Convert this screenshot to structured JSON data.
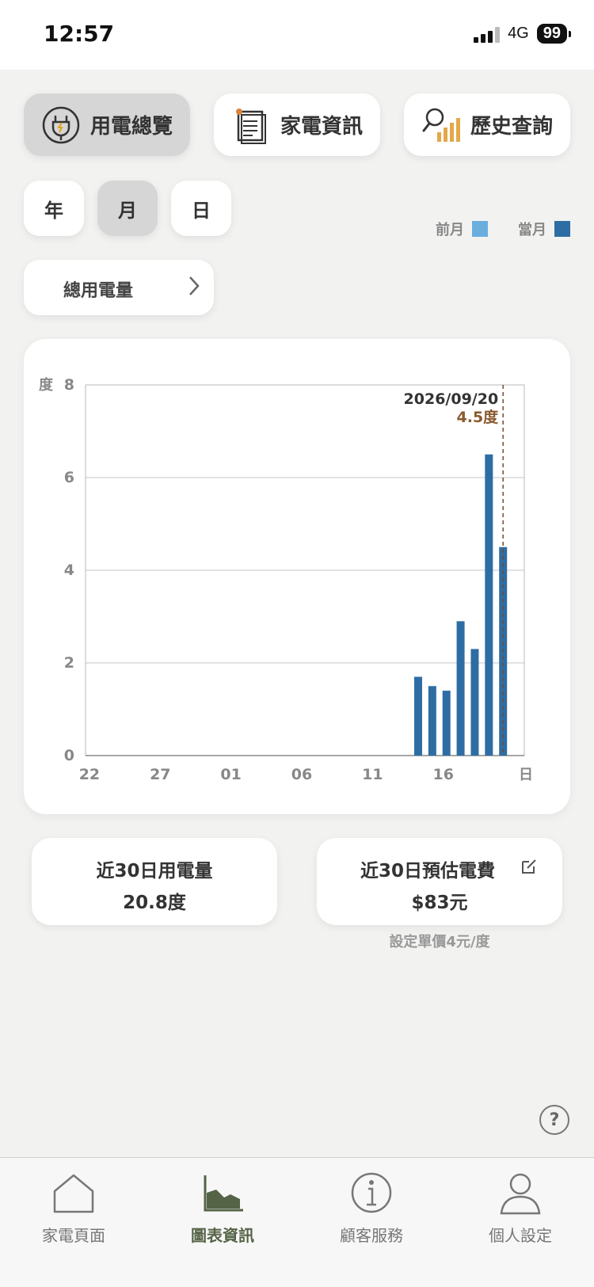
{
  "status_bar": {
    "time": "12:57",
    "network": "4G",
    "battery": "99"
  },
  "top_tabs": [
    {
      "label": "用電總覽",
      "icon": "plug-icon",
      "active": true
    },
    {
      "label": "家電資訊",
      "icon": "document-icon",
      "active": false
    },
    {
      "label": "歷史查詢",
      "icon": "search-chart-icon",
      "active": false
    }
  ],
  "period_tabs": [
    {
      "label": "年",
      "active": false
    },
    {
      "label": "月",
      "active": true
    },
    {
      "label": "日",
      "active": false
    }
  ],
  "legend": {
    "previous": "前月",
    "current": "當月"
  },
  "metric_select": {
    "label": "總用電量"
  },
  "colors": {
    "previous": "#6aaede",
    "current": "#2e6da4",
    "marker": "#7a4a2a",
    "accent": "#556347"
  },
  "chart_data": {
    "type": "bar",
    "ylabel": "度",
    "xlabel": "日",
    "ylim": [
      0,
      8
    ],
    "yticks": [
      0,
      2,
      4,
      6,
      8
    ],
    "xtick_labels": [
      "22",
      "27",
      "01",
      "06",
      "11",
      "16"
    ],
    "xtick_indices": [
      0,
      5,
      10,
      15,
      20,
      25
    ],
    "num_days": 31,
    "series": [
      {
        "name": "當月",
        "points": [
          {
            "day_index": 23,
            "value": 1.7
          },
          {
            "day_index": 24,
            "value": 1.5
          },
          {
            "day_index": 25,
            "value": 1.4
          },
          {
            "day_index": 26,
            "value": 2.9
          },
          {
            "day_index": 27,
            "value": 2.3
          },
          {
            "day_index": 28,
            "value": 6.5
          },
          {
            "day_index": 29,
            "value": 4.5
          }
        ]
      }
    ],
    "selected": {
      "date": "2026/09/20",
      "value_label": "4.5度",
      "day_index": 29
    }
  },
  "stats": {
    "usage_title": "近30日用電量",
    "usage_value": "20.8度",
    "cost_title": "近30日預估電費",
    "cost_value": "$83元",
    "price_note": "設定單價4元/度"
  },
  "help": {
    "label": "?"
  },
  "bottom_nav": [
    {
      "label": "家電頁面",
      "icon": "house-icon",
      "active": false
    },
    {
      "label": "圖表資訊",
      "icon": "area-chart-icon",
      "active": true
    },
    {
      "label": "顧客服務",
      "icon": "info-icon",
      "active": false
    },
    {
      "label": "個人設定",
      "icon": "person-icon",
      "active": false
    }
  ]
}
